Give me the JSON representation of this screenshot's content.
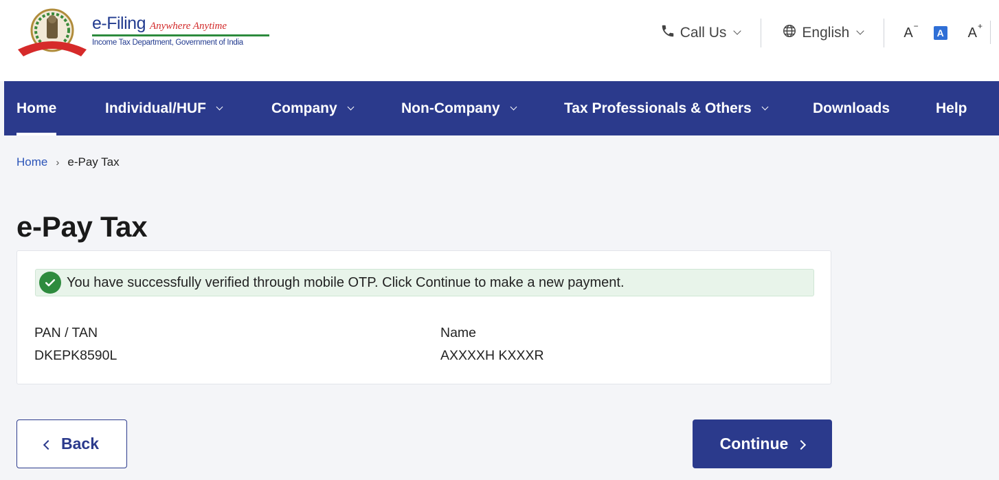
{
  "header": {
    "brand_main": "e-Filing",
    "brand_tagline": "Anywhere Anytime",
    "brand_subtitle": "Income Tax Department, Government of India",
    "call_us": "Call Us",
    "language": "English",
    "font_decrease": "A",
    "font_default": "A",
    "font_increase": "A"
  },
  "nav": {
    "items": [
      {
        "label": "Home"
      },
      {
        "label": "Individual/HUF"
      },
      {
        "label": "Company"
      },
      {
        "label": "Non-Company"
      },
      {
        "label": "Tax Professionals & Others"
      },
      {
        "label": "Downloads"
      },
      {
        "label": "Help"
      }
    ]
  },
  "breadcrumb": {
    "home": "Home",
    "current": "e-Pay Tax"
  },
  "page": {
    "title": "e-Pay Tax",
    "success_message": "You have successfully verified through mobile OTP. Click Continue to make a new payment.",
    "pan_label": "PAN / TAN",
    "pan_value": "DKEPK8590L",
    "name_label": "Name",
    "name_value": "AXXXXH KXXXR"
  },
  "buttons": {
    "back": "Back",
    "continue": "Continue"
  },
  "colors": {
    "nav_bg": "#2b3a8c",
    "success_bg": "#e8f4ea",
    "success_icon": "#2e8b3e",
    "link": "#2b54b8"
  }
}
